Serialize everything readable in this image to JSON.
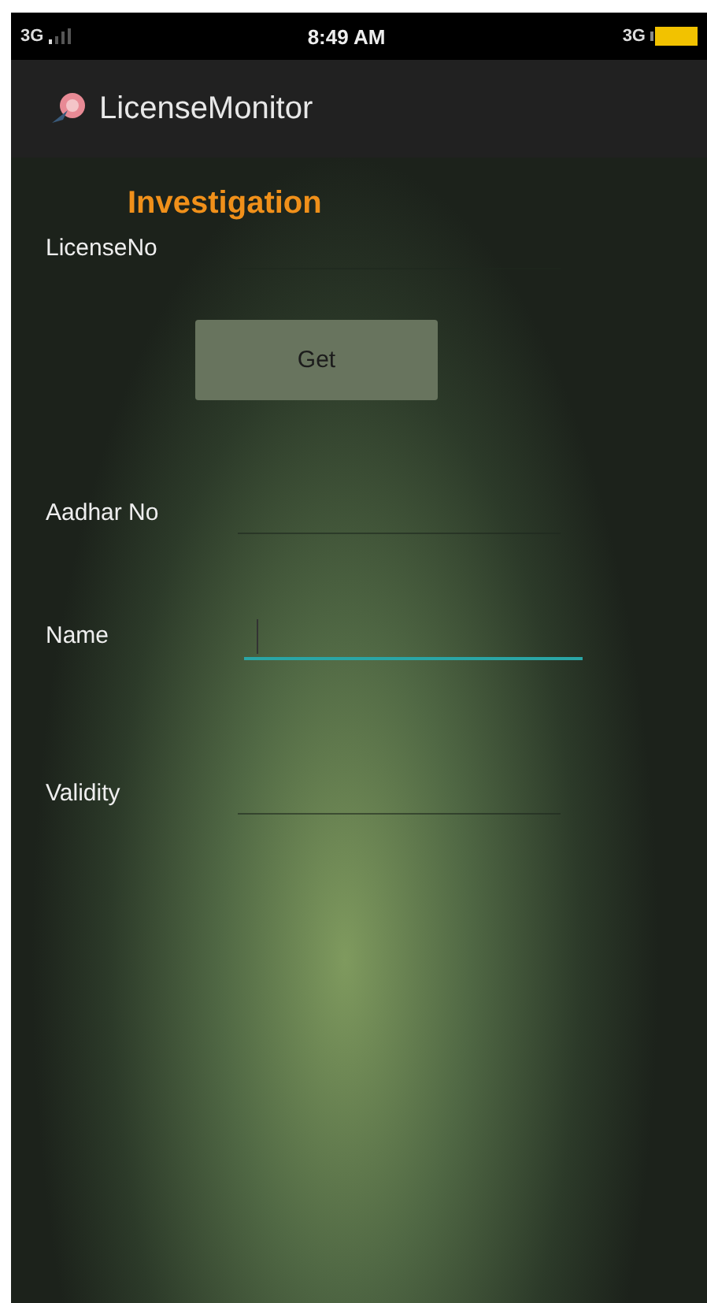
{
  "status_bar": {
    "network_left": "3G",
    "time": "8:49 AM",
    "network_right": "3G"
  },
  "app_bar": {
    "title": "LicenseMonitor"
  },
  "heading": "Investigation",
  "fields": [
    {
      "label": "LicenseNo",
      "focused": false
    },
    {
      "kind": "button",
      "label": "Get"
    },
    {
      "label": "Aadhar No",
      "focused": false
    },
    {
      "label": "Name",
      "focused": true
    },
    {
      "label": "Validity",
      "focused": false
    }
  ]
}
